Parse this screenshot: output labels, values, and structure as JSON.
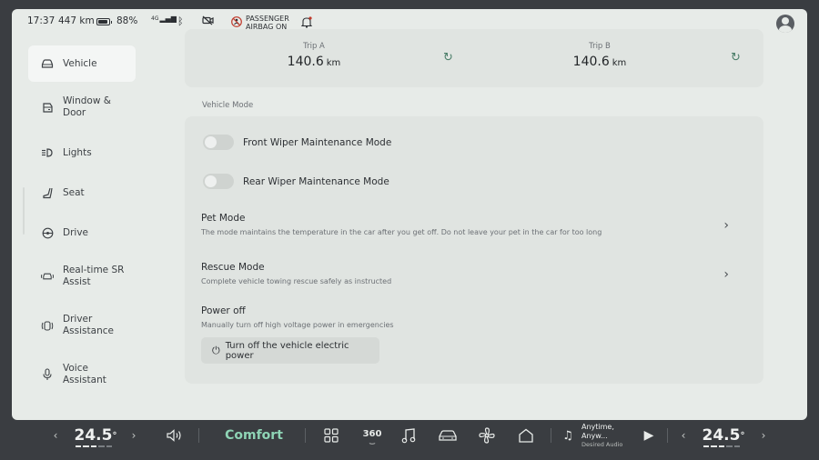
{
  "status": {
    "time": "17:37",
    "range": "447 km",
    "battery": "88%",
    "signal": "4G",
    "airbag_line1": "PASSENGER",
    "airbag_line2": "AIRBAG ON"
  },
  "sidebar": {
    "items": [
      {
        "label": "Vehicle",
        "icon": "car-icon",
        "active": true
      },
      {
        "label": "Window &\nDoor",
        "icon": "door-icon"
      },
      {
        "label": "Lights",
        "icon": "lights-icon"
      },
      {
        "label": "Seat",
        "icon": "seat-icon"
      },
      {
        "label": "Drive",
        "icon": "steering-wheel-icon"
      },
      {
        "label": "Real-time SR\nAssist",
        "icon": "sr-assist-icon"
      },
      {
        "label": "Driver\nAssistance",
        "icon": "driver-assist-icon"
      },
      {
        "label": "Voice\nAssistant",
        "icon": "microphone-icon"
      }
    ]
  },
  "trips": [
    {
      "label": "Trip A",
      "value": "140.6",
      "unit": "km"
    },
    {
      "label": "Trip B",
      "value": "140.6",
      "unit": "km"
    }
  ],
  "vehicle_mode": {
    "section_title": "Vehicle Mode",
    "front_wiper": "Front Wiper Maintenance Mode",
    "rear_wiper": "Rear Wiper Maintenance Mode",
    "pet_mode_title": "Pet Mode",
    "pet_mode_desc": "The mode maintains the temperature in the car after you get off. Do not leave your pet in the car for too long",
    "rescue_title": "Rescue Mode",
    "rescue_desc": "Complete vehicle towing rescue safely as instructed",
    "power_title": "Power off",
    "power_desc": "Manually turn off high voltage power in emergencies",
    "power_button": "Turn off the vehicle electric power"
  },
  "dock": {
    "left_temp": "24.5",
    "right_temp": "24.5",
    "degree": "°",
    "mode": "Comfort",
    "view_360": "360",
    "music_title": "Anytime, Anyw...",
    "music_sub": "Desired Audio"
  }
}
